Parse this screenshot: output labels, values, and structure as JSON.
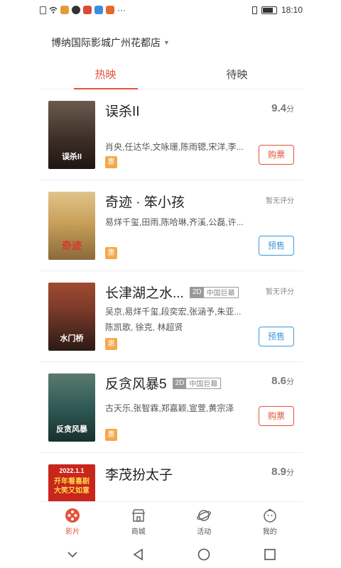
{
  "status": {
    "time": "18:10",
    "dots": "···"
  },
  "header": {
    "cinema_name": "博纳国际影城广州花都店"
  },
  "tabs": [
    {
      "label": "热映"
    },
    {
      "label": "待映"
    }
  ],
  "movies": [
    {
      "title": "误杀II",
      "score": "9.4",
      "score_unit": "分",
      "cast1": "肖央,任达华,文咏珊,陈雨锶,宋洋,李...",
      "badge": "惠",
      "button": "购票",
      "poster_text": "误杀II",
      "colors": {
        "poster": "#4a3a32"
      }
    },
    {
      "title": "奇迹 · 笨小孩",
      "score": "暂无评分",
      "cast1": "易烊千玺,田雨,陈哈琳,齐溪,公磊,许...",
      "badge": "惠",
      "button": "预售",
      "poster_text": "奇迹",
      "colors": {
        "poster": "#c9a05a"
      }
    },
    {
      "title": "长津湖之水...",
      "tag_2d": "2D",
      "tag_label": "中国巨幕",
      "score": "暂无评分",
      "cast1": "吴京,易烊千玺,段奕宏,张涵予,朱亚...",
      "cast2": "陈凯歌, 徐克, 林超贤",
      "badge": "惠",
      "button": "预售",
      "poster_text": "水门桥",
      "colors": {
        "poster": "#7a3a2a"
      }
    },
    {
      "title": "反贪风暴5",
      "tag_2d": "2D",
      "tag_label": "中国巨幕",
      "score": "8.6",
      "score_unit": "分",
      "cast1": "古天乐,张智霖,郑嘉颖,宣萱,黄宗泽",
      "badge": "惠",
      "button": "购票",
      "poster_text": "反贪风暴",
      "colors": {
        "poster": "#2f5a55"
      }
    },
    {
      "title": "李茂扮太子",
      "score": "8.9",
      "score_unit": "分",
      "poster_top": "2022.1.1",
      "poster_text": "开年看喜剧 大笑又如意",
      "colors": {
        "poster": "#c8261c"
      }
    }
  ],
  "bottom_nav": [
    {
      "label": "影片",
      "icon": "film-reel-icon"
    },
    {
      "label": "商城",
      "icon": "store-icon"
    },
    {
      "label": "活动",
      "icon": "planet-icon"
    },
    {
      "label": "我的",
      "icon": "face-icon"
    }
  ],
  "colors": {
    "accent": "#e4533a",
    "presale": "#3f98d9",
    "badge": "#f6a74a"
  }
}
